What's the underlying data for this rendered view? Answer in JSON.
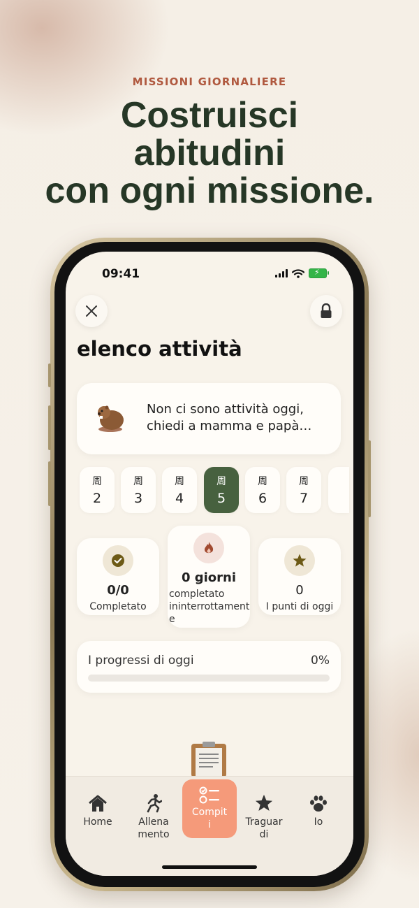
{
  "promo": {
    "kicker": "MISSIONI GIORNALIERE",
    "headline_line1": "Costruisci",
    "headline_line2": "abitudini",
    "headline_line3": "con ogni missione."
  },
  "status_bar": {
    "time": "09:41"
  },
  "header": {
    "close_icon": "close-icon",
    "lock_icon": "lock-icon",
    "title": "elenco attività"
  },
  "notice": {
    "icon": "beaver-emoji",
    "line1": "Non ci sono attività oggi,",
    "line2": "chiedi a mamma e papà…"
  },
  "days": [
    {
      "week": "周",
      "num": "2",
      "active": false
    },
    {
      "week": "周",
      "num": "3",
      "active": false
    },
    {
      "week": "周",
      "num": "4",
      "active": false
    },
    {
      "week": "周",
      "num": "5",
      "active": true
    },
    {
      "week": "周",
      "num": "6",
      "active": false
    },
    {
      "week": "周",
      "num": "7",
      "active": false
    }
  ],
  "stats": {
    "completed": {
      "value": "0/0",
      "label": "Completato",
      "icon": "check-circle-icon"
    },
    "streak": {
      "value": "0 giorni",
      "label_line1": "completato",
      "label_line2": "ininterrottament",
      "label_line3": "e",
      "icon": "flame-icon"
    },
    "points": {
      "value": "0",
      "label": "I punti di oggi",
      "icon": "star-icon"
    }
  },
  "progress": {
    "label": "I progressi di oggi",
    "percent_text": "0%",
    "value": 0
  },
  "tabs": [
    {
      "label_line1": "Home",
      "label_line2": "",
      "icon": "home-icon"
    },
    {
      "label_line1": "Allena",
      "label_line2": "mento",
      "icon": "running-icon"
    },
    {
      "label_line1": "Compit",
      "label_line2": "i",
      "icon": "checklist-icon",
      "active": true
    },
    {
      "label_line1": "Traguar",
      "label_line2": "di",
      "icon": "star-icon"
    },
    {
      "label_line1": "Io",
      "label_line2": "",
      "icon": "paw-icon"
    }
  ],
  "colors": {
    "headline": "#263726",
    "kicker": "#b0593f",
    "accent_green": "#47613f",
    "tab_active": "#f59a7a",
    "background": "#f8f3ea"
  }
}
